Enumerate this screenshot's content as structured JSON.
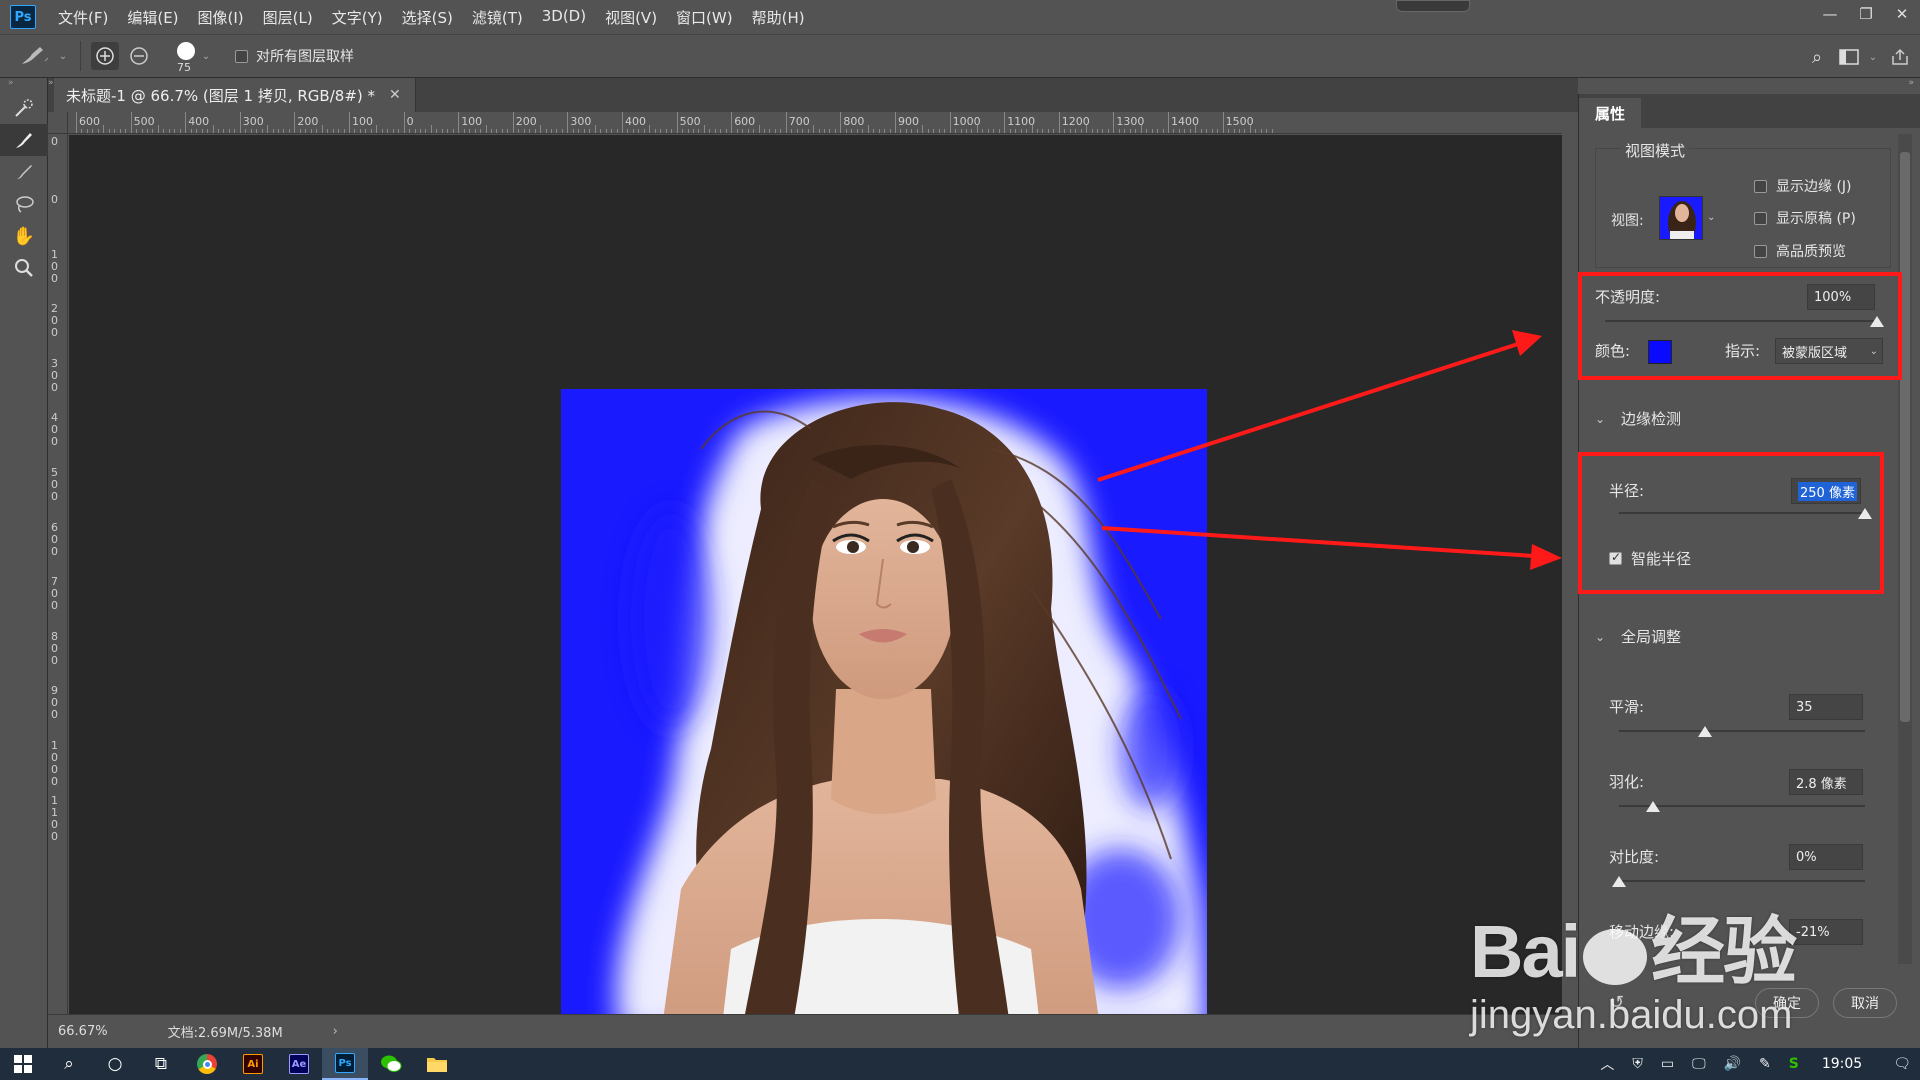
{
  "app": {
    "logo": "Ps"
  },
  "menu": [
    "文件(F)",
    "编辑(E)",
    "图像(I)",
    "图层(L)",
    "文字(Y)",
    "选择(S)",
    "滤镜(T)",
    "3D(D)",
    "视图(V)",
    "窗口(W)",
    "帮助(H)"
  ],
  "options_bar": {
    "brush_size": "75",
    "sample_all_layers_label": "对所有图层取样",
    "sample_all_layers_checked": false
  },
  "document": {
    "tab_title": "未标题-1 @ 66.7% (图层 1 拷贝, RGB/8#) *",
    "zoom": "66.67%",
    "doc_size": "文档:2.69M/5.38M",
    "ruler_top": [
      "600",
      "500",
      "400",
      "300",
      "200",
      "100",
      "0",
      "100",
      "200",
      "300",
      "400",
      "500",
      "600",
      "700",
      "800",
      "900",
      "1000",
      "1100",
      "1200",
      "1300",
      "1400",
      "1500"
    ],
    "ruler_left": [
      "0",
      "0",
      "100",
      "200",
      "300",
      "400",
      "500",
      "600",
      "700",
      "800",
      "900",
      "1000",
      "1100"
    ],
    "overlay_color": "#1a1aff"
  },
  "properties": {
    "tab": "属性",
    "view_mode": {
      "section": "视图模式",
      "view_label": "视图:",
      "show_edge": "显示边缘 (J)",
      "show_original": "显示原稿 (P)",
      "hq_preview": "高品质预览"
    },
    "opacity": {
      "label": "不透明度:",
      "value": "100%",
      "level": 1.0
    },
    "color": {
      "label": "颜色:",
      "swatch": "#0a0aff",
      "indicate_label": "指示:",
      "indicate_value": "被蒙版区域"
    },
    "edge_detection": {
      "section": "边缘检测",
      "radius_label": "半径:",
      "radius_value": "250 像素",
      "radius_level": 1.0,
      "smart_radius_label": "智能半径",
      "smart_radius_checked": true
    },
    "global": {
      "section": "全局调整",
      "smooth_label": "平滑:",
      "smooth_value": "35",
      "smooth_level": 0.35,
      "feather_label": "羽化:",
      "feather_value": "2.8 像素",
      "feather_level": 0.14,
      "contrast_label": "对比度:",
      "contrast_value": "0%",
      "contrast_level": 0.0,
      "shift_label": "移动边缘:",
      "shift_value": "-21%"
    },
    "ok": "确定",
    "cancel": "取消"
  },
  "taskbar": {
    "time": "19:05"
  },
  "watermark": {
    "logo": "Bai du 经验",
    "url": "jingyan.baidu.com"
  },
  "annotation_color": "#ff1a1a"
}
